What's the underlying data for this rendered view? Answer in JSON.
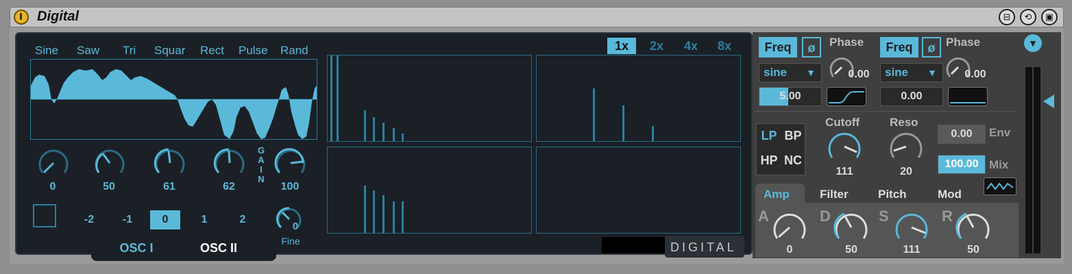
{
  "device": {
    "title": "Digital"
  },
  "titlebar": {
    "power_icon": "power-icon",
    "buttons": [
      {
        "name": "fold-button",
        "icon": "fold-icon"
      },
      {
        "name": "hot-swap-button",
        "icon": "hot-swap-icon"
      },
      {
        "name": "save-preset-button",
        "icon": "save-icon"
      }
    ]
  },
  "oscillator": {
    "waveforms": [
      "Sine",
      "Saw",
      "Tri",
      "Squar",
      "Rect",
      "Pulse",
      "Rand"
    ],
    "knobs": [
      {
        "value": "0",
        "level": 0.0
      },
      {
        "value": "50",
        "level": 0.39
      },
      {
        "value": "61",
        "level": 0.48
      },
      {
        "value": "62",
        "level": 0.49
      }
    ],
    "gain": {
      "label": "GAIN",
      "value": "100",
      "level": 0.79
    },
    "steps": [
      "-2",
      "-1",
      "0",
      "1",
      "2"
    ],
    "selected_step": "0",
    "fine": {
      "label": "Fine",
      "value": "0"
    },
    "tabs": [
      "OSC I",
      "OSC II"
    ],
    "active_tab": "OSC I"
  },
  "spectrum": {
    "oversampling": [
      "1x",
      "2x",
      "4x",
      "8x"
    ],
    "selected_oversampling": "1x",
    "logo": "DIGITAL"
  },
  "lfo": {
    "left": {
      "freq_label": "Freq",
      "phase_invert": "ø",
      "phase_label": "Phase",
      "phase_value": "0.00",
      "shape": "sine",
      "rate": "5.00"
    },
    "right": {
      "freq_label": "Freq",
      "phase_invert": "ø",
      "phase_label": "Phase",
      "phase_value": "0.00",
      "shape": "sine",
      "rate": "0.00"
    }
  },
  "filter": {
    "types": [
      "LP",
      "BP",
      "HP",
      "NC"
    ],
    "selected_type": "LP",
    "cutoff": {
      "label": "Cutoff",
      "value": "111"
    },
    "reso": {
      "label": "Reso",
      "value": "20"
    },
    "env": {
      "label": "Env",
      "value": "0.00"
    },
    "mix": {
      "label": "Mix",
      "value": "100.00"
    }
  },
  "envelope": {
    "tabs": [
      "Amp",
      "Filter",
      "Pitch",
      "Mod"
    ],
    "active_tab": "Amp",
    "adsr": [
      {
        "label": "A",
        "value": "0"
      },
      {
        "label": "D",
        "value": "50"
      },
      {
        "label": "S",
        "value": "111"
      },
      {
        "label": "R",
        "value": "50"
      }
    ]
  },
  "colors": {
    "accent": "#5ab9d9",
    "panel": "#1a2026",
    "right_panel": "#3f3f3f",
    "power": "#e5b52a"
  }
}
